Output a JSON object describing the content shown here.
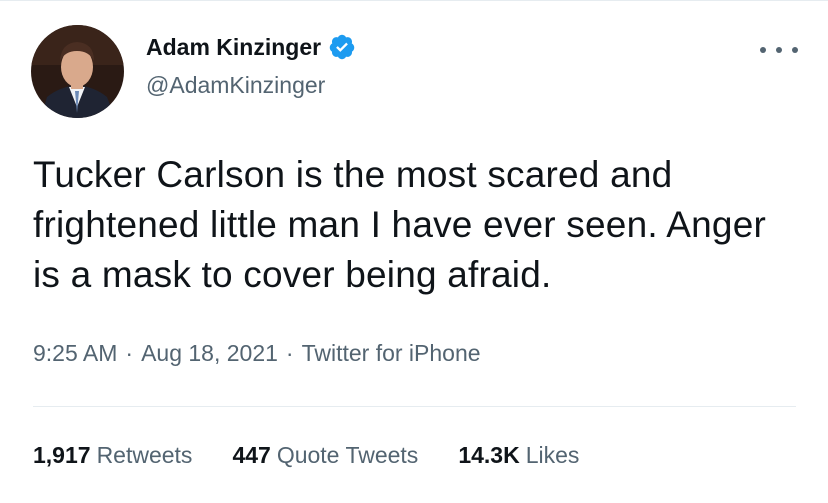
{
  "user": {
    "display_name": "Adam Kinzinger",
    "handle": "@AdamKinzinger",
    "verified": true,
    "verified_color": "#1d9bf0"
  },
  "tweet": {
    "text": "Tucker Carlson is the most scared and frightened little man I have ever seen. Anger is a mask to cover being afraid.",
    "time": "9:25 AM",
    "date": "Aug 18, 2021",
    "separator": "·",
    "source": "Twitter for iPhone"
  },
  "stats": {
    "retweets": {
      "count": "1,917",
      "label": "Retweets"
    },
    "quotes": {
      "count": "447",
      "label": "Quote Tweets"
    },
    "likes": {
      "count": "14.3K",
      "label": "Likes"
    }
  },
  "icons": {
    "more": "more-options-icon",
    "verified": "verified-badge-icon"
  },
  "colors": {
    "text_primary": "#0f1419",
    "text_secondary": "#536471",
    "divider": "#e6ecf0",
    "accent": "#1d9bf0"
  }
}
